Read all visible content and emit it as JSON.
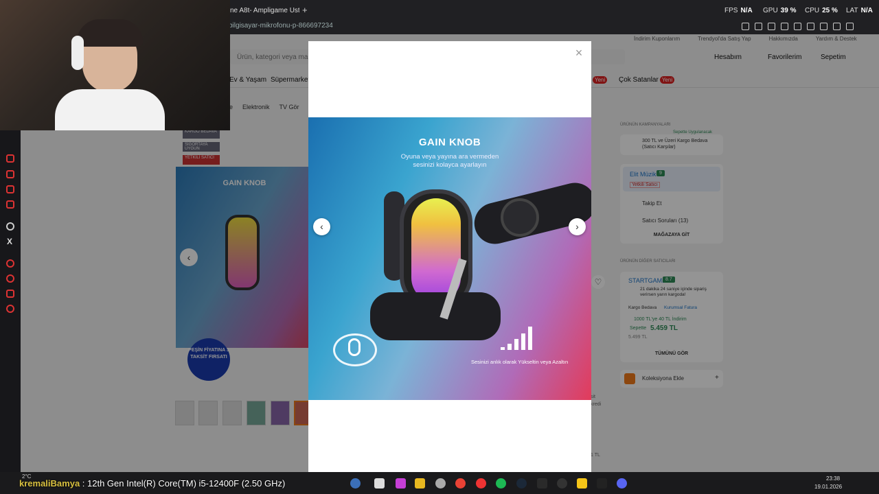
{
  "browser": {
    "tab_title": "fine A8t- Ampligame Ust",
    "url": "bilgisayar-mikrofonu-p-866697234",
    "new_tab": "+"
  },
  "overlay": {
    "fps_label": "FPS",
    "fps_value": "N/A",
    "gpu_label": "GPU",
    "gpu_value": "39 %",
    "cpu_label": "CPU",
    "cpu_value": "25 %",
    "lat_label": "LAT",
    "lat_value": "N/A"
  },
  "site": {
    "top_links": [
      "İndirim Kuponlarım",
      "Trendyol'da Satış Yap",
      "Hakkımızda",
      "Yardım & Destek"
    ],
    "search_placeholder": "Ürün, kategori veya marka",
    "account": "Hesabım",
    "favorites": "Favorilerim",
    "cart": "Sepetim",
    "nav_items": [
      "Ev & Yaşam",
      "Süpermarket"
    ],
    "nav_new": "Yeni",
    "bestsellers": "Çok Satanlar",
    "breadcrumb": [
      "e",
      "Elektronik",
      "TV Gör"
    ],
    "tags": [
      "KARGO BEDAVA",
      "SİGORTAYA UYGUN",
      "YETKİLİ SATICI"
    ],
    "promo": "PEŞİN FİYATINA 3 TAKSİT FIRSATI",
    "campaigns_title": "ÜRÜNÜN KAMPANYALARI",
    "campaign_tag": "Sepette Uygulanacak",
    "campaign": "300 TL ve Üzeri Kargo Bedava (Satıcı Karşılar)",
    "seller_name": "Elit Müzik",
    "seller_score": "9",
    "seller_badge": "Yetkili Satıcı",
    "follow": "Takip Et",
    "seller_questions": "Satıcı Soruları (13)",
    "store_btn": "MAĞAZAYA GİT",
    "other_sellers": "ÜRÜNÜN DİĞER SATICILARI",
    "other_seller_name": "STARTGAME",
    "other_seller_score": "8.7",
    "delivery": "21 dakika 24 saniye içinde sipariş verirsen yarın kargoda!",
    "chip1": "Kargo Bedava",
    "chip2": "Kurumsal Fatura",
    "discount": "1000 TL'ye 40 TL İndirim",
    "cart_price_label": "Sepette",
    "cart_price": "5.459 TL",
    "old_price": "5.499 TL",
    "see_all": "TÜMÜNÜ GÖR",
    "collection": "Koleksiyona Ekle",
    "side_texts": [
      "sit",
      "kredi",
      "1 TL"
    ]
  },
  "product_image": {
    "title": "GAIN KNOB",
    "subtitle_line1": "Oyuna veya yayına ara vermeden",
    "subtitle_line2": "sesinizi kolayca ayarlayın",
    "caption": "Sesinizi anlık olarak Yükseltin veya Azaltın"
  },
  "modal": {
    "close": "×",
    "prev": "‹",
    "next": "›"
  },
  "taskbar": {
    "temp": "2°C",
    "user": "kremaliBamya",
    "sep": " : ",
    "cpu_model": "12th Gen Intel(R) Core(TM) i5-12400F (2.50 GHz)",
    "time": "23:38",
    "date": "19.01.2026"
  },
  "colors": {
    "accent": "#f27a1a",
    "danger": "#d22",
    "seller_green": "#2e8b57"
  },
  "icons": [
    "refresh-icon",
    "bag-icon",
    "monitor-icon",
    "mail-icon",
    "openai-icon",
    "x-icon",
    "play-icon",
    "clock-icon",
    "gear-icon"
  ]
}
